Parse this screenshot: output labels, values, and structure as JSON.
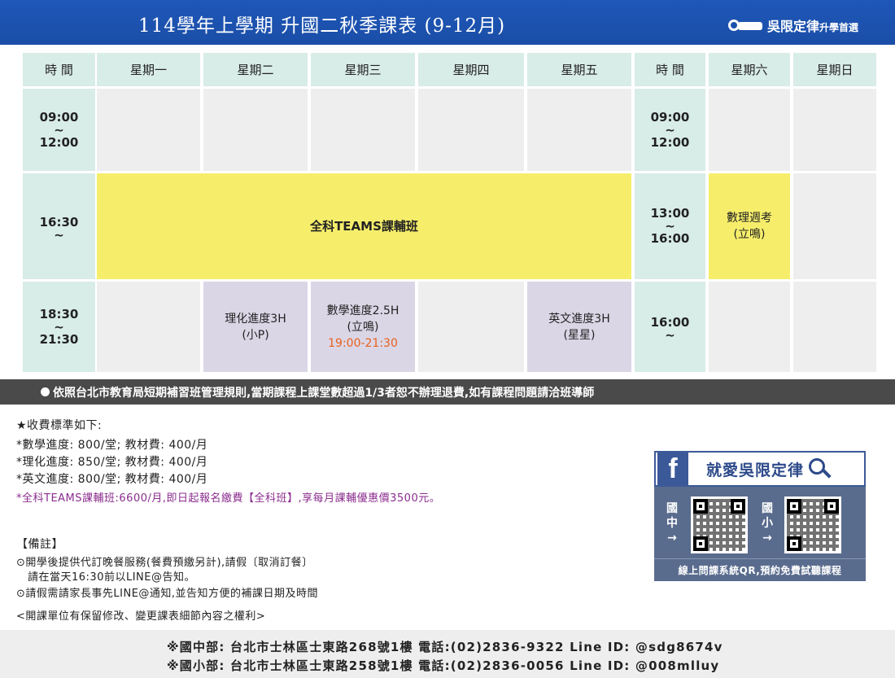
{
  "header": {
    "title": "114學年上學期  升國二秋季課表 (9-12月)",
    "brand": "吳限定律",
    "brand_suffix": "升學首選"
  },
  "schedule": {
    "headers": [
      "時 間",
      "星期一",
      "星期二",
      "星期三",
      "星期四",
      "星期五",
      "時 間",
      "星期六",
      "星期日"
    ],
    "weekday_times": [
      {
        "start": "09:00",
        "sep": "~",
        "end": "12:00"
      },
      {
        "start": "16:30",
        "sep": "~",
        "end": ""
      },
      {
        "start": "18:30",
        "sep": "~",
        "end": "21:30"
      }
    ],
    "weekend_times": [
      {
        "start": "09:00",
        "sep": "~",
        "end": "12:00"
      },
      {
        "start": "13:00",
        "sep": "~",
        "end": "16:00"
      },
      {
        "start": "16:00",
        "sep": "~",
        "end": ""
      }
    ],
    "teams_class": "全科TEAMS課輔班",
    "saturday_quiz": {
      "line1": "數理週考",
      "line2": "(立鳴)"
    },
    "tuesday_evening": {
      "line1": "理化進度3H",
      "line2": "(小P)"
    },
    "wednesday_evening": {
      "line1": "數學進度2.5H",
      "line2": "(立鳴)",
      "line3": "19:00-21:30"
    },
    "friday_evening": {
      "line1": "英文進度3H",
      "line2": "(星星)"
    }
  },
  "rule_notice": "依照台北市教育局短期補習班管理規則,當期課程上課堂數超過1/3者恕不辦理退費,如有課程問題請洽班導師",
  "fees": {
    "title": "★收費標準如下:",
    "items": [
      "*數學進度: 800/堂; 教材費: 400/月",
      "*理化進度: 850/堂; 教材費: 400/月",
      "*英文進度: 800/堂; 教材費: 400/月"
    ],
    "teams_offer": "*全科TEAMS課輔班:6600/月,即日起報名繳費【全科班】,享每月課輔優惠價3500元。"
  },
  "notes": {
    "title": "【備註】",
    "lines": [
      "⊙開學後提供代訂晚餐服務(餐費預繳另計),請假〔取消訂餐〕",
      "請在當天16:30前以LINE@告知。",
      "⊙請假需請家長事先LINE@通知,並告知方便的補課日期及時間"
    ],
    "rights": "<開課單位有保留修改、變更課表細節內容之權利>"
  },
  "facebook": {
    "title": "就愛吳限定律",
    "junior_label": [
      "國",
      "中",
      "→"
    ],
    "elementary_label": [
      "國",
      "小",
      "→"
    ],
    "caption": "線上問課系統QR,預約免費試聽課程"
  },
  "footer": {
    "junior": "※國中部: 台北市士林區士東路268號1樓   電話:(02)2836-9322   Line ID: @sdg8674v",
    "elementary": "※國小部: 台北市士林區士東路258號1樓   電話:(02)2836-0056   Line ID: @008mlluy"
  }
}
